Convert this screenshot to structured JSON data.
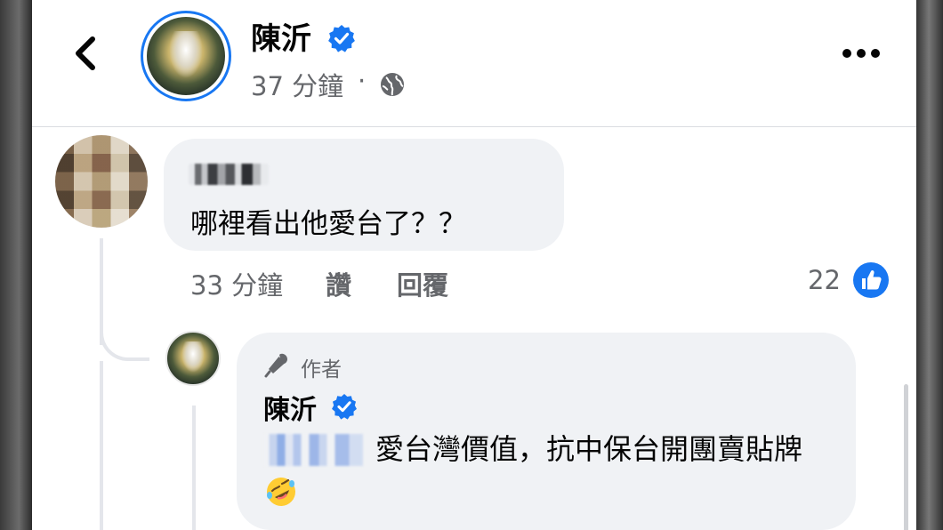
{
  "header": {
    "author_name": "陳沂",
    "post_time": "37 分鐘",
    "dot": "·",
    "back_icon": "chevron-left-icon",
    "more_icon": "ellipsis-icon",
    "privacy_icon": "globe-icon"
  },
  "comment": {
    "author_name_blurred": true,
    "text": "哪裡看出他愛台了？？",
    "time": "33 分鐘",
    "like_label": "讚",
    "reply_label": "回覆",
    "like_count": "22"
  },
  "reply": {
    "badge_label": "作者",
    "author_name": "陳沂",
    "mention_blurred": true,
    "text": "愛台灣價值，抗中保台開團賣貼牌",
    "emoji": "rolling-on-floor-laughing"
  },
  "colors": {
    "accent": "#1877f2",
    "text_primary": "#050505",
    "text_secondary": "#65676b",
    "bubble": "#f0f2f5"
  }
}
